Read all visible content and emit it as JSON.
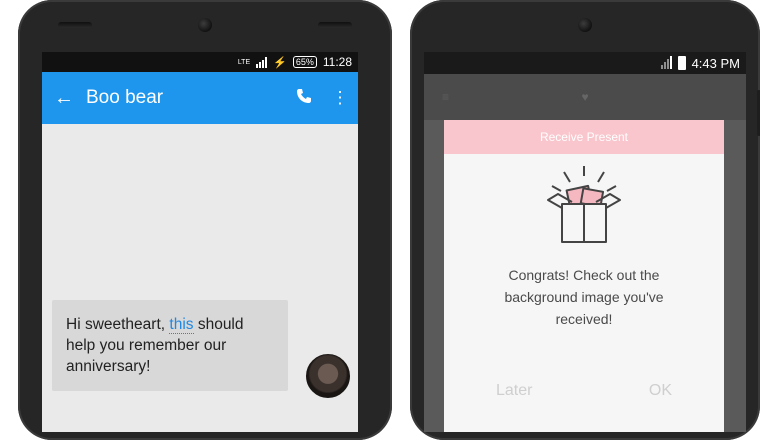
{
  "left_phone": {
    "statusbar": {
      "network_label": "LTE",
      "battery_percent": "65%",
      "time": "11:28",
      "icons": [
        "signal-icon",
        "charging-bolt-icon",
        "battery-icon"
      ]
    },
    "appbar": {
      "contact_name": "Boo bear",
      "icons": [
        "back-arrow-icon",
        "phone-icon",
        "overflow-menu-icon"
      ]
    },
    "message": {
      "text_before": "Hi sweetheart, ",
      "link_word": "this",
      "text_after": " should help you remember our anniversary!"
    }
  },
  "right_phone": {
    "statusbar": {
      "time": "4:43 PM",
      "icons": [
        "signal-icon",
        "battery-icon"
      ]
    },
    "dialog": {
      "header": "Receive Present",
      "message": "Congrats! Check out the background image you've received!",
      "later_button": "Later",
      "ok_button": "OK",
      "icon": "gift-box-icon"
    }
  },
  "colors": {
    "appbar": "#1e96ee",
    "dialog_header": "#f8c6cc",
    "link": "#1e88e5",
    "bubble": "#d8d8d8"
  }
}
